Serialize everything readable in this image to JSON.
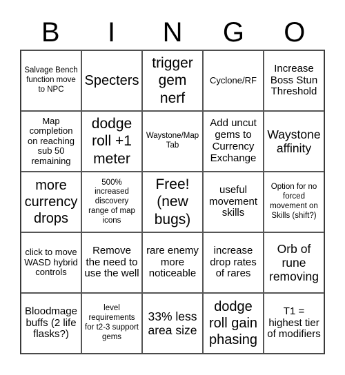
{
  "title_letters": [
    "B",
    "I",
    "N",
    "G",
    "O"
  ],
  "cells": [
    "Salvage Bench function move to NPC",
    "Specters",
    "trigger gem nerf",
    "Cyclone/RF",
    "Increase Boss Stun Threshold",
    "Map completion on reaching sub 50 remaining",
    "dodge roll +1 meter",
    "Waystone/Map Tab",
    "Add uncut gems to Currency Exchange",
    "Waystone affinity",
    "more currency drops",
    "500% increased discovery range of map icons",
    "Free! (new bugs)",
    "useful movement skills",
    "Option for no forced movement on Skills (shift?)",
    "click to move WASD hybrid controls",
    "Remove the need to use the well",
    "rare enemy more noticeable",
    "increase drop rates of rares",
    "Orb of rune removing",
    "Bloodmage buffs (2 life flasks?)",
    "level requirements for t2-3 support gems",
    "33% less area size",
    "dodge roll gain phasing",
    "T1 = highest tier of modifiers"
  ]
}
